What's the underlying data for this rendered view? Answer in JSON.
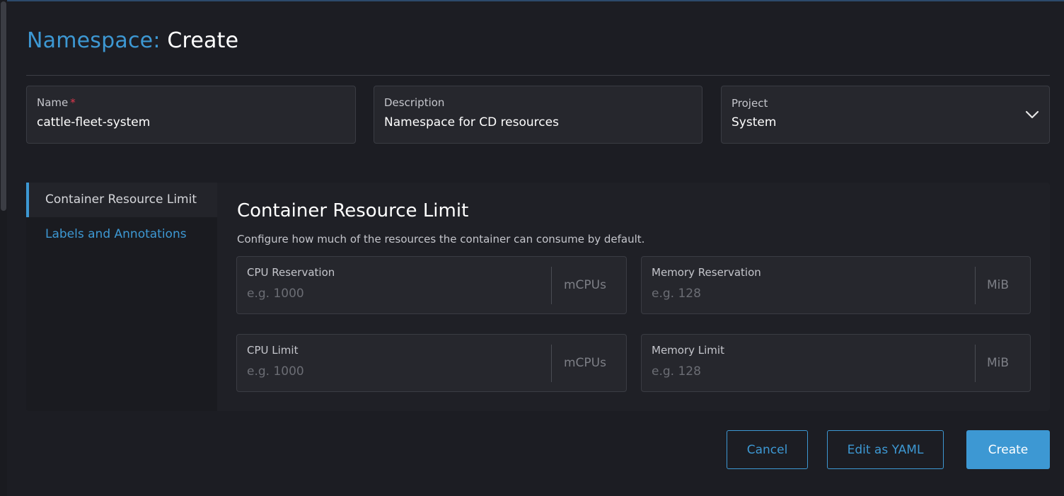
{
  "header": {
    "title_prefix": "Namespace:",
    "title_main": "Create"
  },
  "fields": {
    "name": {
      "label": "Name",
      "required_mark": "*",
      "value": "cattle-fleet-system"
    },
    "description": {
      "label": "Description",
      "value": "Namespace for CD resources"
    },
    "project": {
      "label": "Project",
      "value": "System",
      "icon": "chevron-down-icon"
    }
  },
  "tabs": [
    {
      "label": "Container Resource Limit",
      "active": true
    },
    {
      "label": "Labels and Annotations",
      "active": false
    }
  ],
  "section": {
    "title": "Container Resource Limit",
    "description": "Configure how much of the resources the container can consume by default."
  },
  "limits": {
    "cpu_reservation": {
      "label": "CPU Reservation",
      "placeholder": "e.g. 1000",
      "unit": "mCPUs"
    },
    "memory_reservation": {
      "label": "Memory Reservation",
      "placeholder": "e.g. 128",
      "unit": "MiB"
    },
    "cpu_limit": {
      "label": "CPU Limit",
      "placeholder": "e.g. 1000",
      "unit": "mCPUs"
    },
    "memory_limit": {
      "label": "Memory Limit",
      "placeholder": "e.g. 128",
      "unit": "MiB"
    }
  },
  "buttons": {
    "cancel": "Cancel",
    "edit_yaml": "Edit as YAML",
    "create": "Create"
  },
  "colors": {
    "accent": "#3d98d3",
    "background": "#1c1d23",
    "required": "#e0374d"
  }
}
